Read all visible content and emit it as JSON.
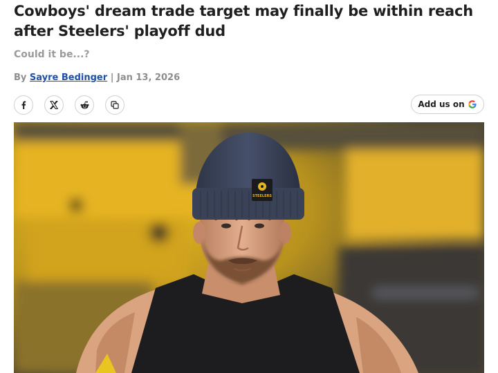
{
  "article": {
    "headline": "Cowboys' dream trade target may finally be within reach after Steelers' playoff dud",
    "dek": "Could it be...?",
    "byline": {
      "prefix": "By",
      "author": "Sayre Bedinger",
      "separator": "|",
      "date": "Jan 13, 2026"
    }
  },
  "share": {
    "icons": [
      "facebook-icon",
      "x-icon",
      "reddit-icon",
      "copy-link-icon"
    ]
  },
  "add_us": {
    "label": "Add us on",
    "icon": "google-icon"
  },
  "hero": {
    "hat_text": "STEELERS",
    "colors": {
      "stadium_yellow": "#e3b21c",
      "beanie": "#3c4458",
      "jersey": "#1d1d1f",
      "skin": "#d8a283"
    }
  },
  "colors": {
    "headline": "#1f1f1f",
    "dek": "#9a9a9a",
    "author_link": "#1f4fa8"
  }
}
